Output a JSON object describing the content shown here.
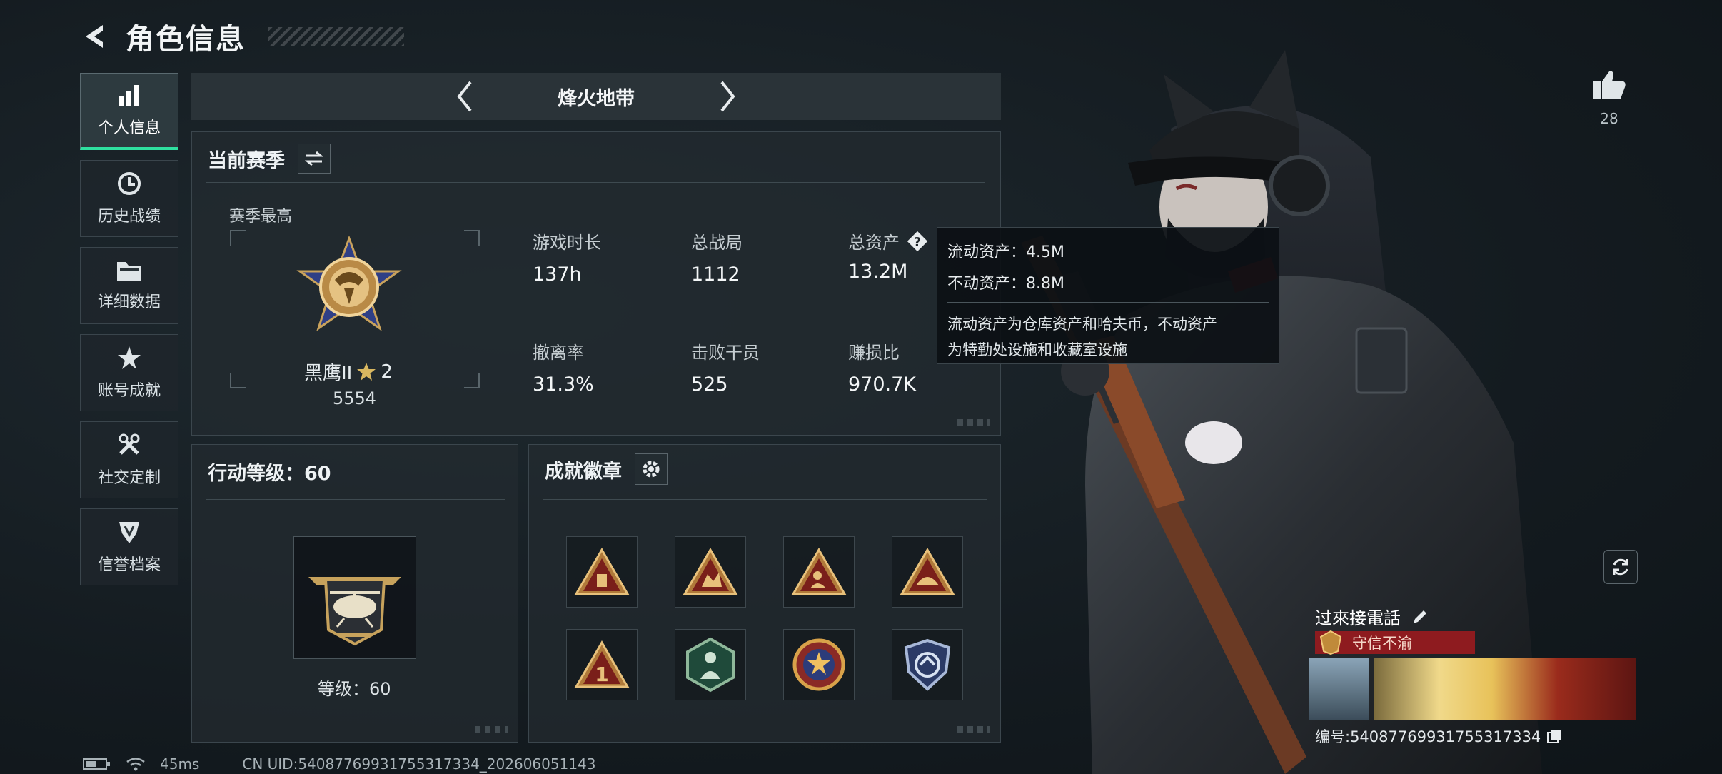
{
  "header": {
    "title": "角色信息"
  },
  "nav": {
    "items": [
      {
        "label": "个人信息",
        "icon": "bar-chart-icon",
        "active": true
      },
      {
        "label": "历史战绩",
        "icon": "history-icon",
        "active": false
      },
      {
        "label": "详细数据",
        "icon": "folder-icon",
        "active": false
      },
      {
        "label": "账号成就",
        "icon": "achievement-icon",
        "active": false
      },
      {
        "label": "社交定制",
        "icon": "wrench-icon",
        "active": false
      },
      {
        "label": "信誉档案",
        "icon": "reputation-icon",
        "active": false
      }
    ]
  },
  "mode": {
    "name": "烽火地带"
  },
  "season": {
    "title": "当前赛季",
    "best_label": "赛季最高",
    "rank_name": "黑鹰II",
    "rank_stars": "2",
    "rank_score": "5554",
    "stats": [
      {
        "label": "游戏时长",
        "value": "137h"
      },
      {
        "label": "总战局",
        "value": "1112"
      },
      {
        "label": "总资产",
        "value": "13.2M"
      },
      {
        "label": "撤离率",
        "value": "31.3%"
      },
      {
        "label": "击败干员",
        "value": "525"
      },
      {
        "label": "赚损比",
        "value": "970.7K"
      }
    ]
  },
  "tooltip": {
    "line1": "流动资产：4.5M",
    "line2": "不动资产：8.8M",
    "desc1": "流动资产为仓库资产和哈夫币，不动资产",
    "desc2": "为特勤处设施和收藏室设施"
  },
  "action": {
    "title": "行动等级：60",
    "level_text": "等级：60"
  },
  "badges": {
    "title": "成就徽章",
    "items": [
      "badge-triangle-1",
      "badge-triangle-2",
      "badge-triangle-3",
      "badge-triangle-4",
      "badge-triangle-5",
      "badge-hexagon",
      "badge-star-seal",
      "badge-shield"
    ]
  },
  "like": {
    "count": "28"
  },
  "card": {
    "name": "过來接電話",
    "title": "守信不渝",
    "id": "编号:5408776993175531733​4"
  },
  "status": {
    "ping": "45ms",
    "uid": "CN UID:5408776993175531733​4_202606051143"
  },
  "colors": {
    "accent": "#2fe0a0",
    "title_bar": "#8e1b1f"
  }
}
